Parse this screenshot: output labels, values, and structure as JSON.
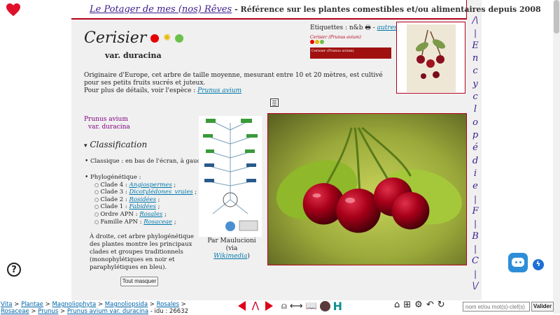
{
  "header": {
    "brand": "Le Potager de mes (nos) Rêves",
    "tagline": "- Référence sur les plantes comestibles et/ou alimentaires depuis 2008"
  },
  "plant": {
    "name": "Cerisier",
    "variety": "var. duracina",
    "description": "Originaire d'Europe, cet arbre de taille moyenne, mesurant entre 10 et 20 mètres, est cultivé pour ses petits fruits sucrés et juteux.",
    "details_prefix": "Pour plus de détails, voir l'espèce :",
    "details_link": "Prunus avium"
  },
  "labels": {
    "title": "Etiquettes : n&b",
    "others_link": "autres ex.",
    "mini_caption": "Cerisier (Prunus avium)",
    "mini_bar": "Cerisier (Prunus avium)"
  },
  "species": {
    "genus": "Prunus avium",
    "variety": "var. duracina"
  },
  "classification": {
    "heading": "Classification",
    "classic": "Classique : en bas de l'écran, à gauche.",
    "phylo_title": "Phylogénétique :",
    "items": [
      {
        "prefix": "Clade 4 : ",
        "link": "Angiospermes",
        "suffix": " ;"
      },
      {
        "prefix": "Clade 3 : ",
        "link": "Dicotylédones_vraies",
        "suffix": " ;"
      },
      {
        "prefix": "Clade 2 : ",
        "link": "Rosidées",
        "suffix": " ;"
      },
      {
        "prefix": "Clade 1 : ",
        "link": "Fabidées",
        "suffix": " ;"
      },
      {
        "prefix": "Ordre APN : ",
        "link": "Rosales",
        "suffix": " ;"
      },
      {
        "prefix": "Famille APN : ",
        "link": "Rosaceae",
        "suffix": " ;"
      }
    ],
    "note": "À droite, cet arbre phylogénétique des plantes montre les principaux clades et groupes traditionnels (monophylétiques en noir et paraphylétiques en bleu).",
    "credit_prefix": "Par Maulucioni",
    "credit_via": "(via ",
    "credit_link": "Wikimedia",
    "credit_close": ")"
  },
  "buttons": {
    "hide_all": "Tout masquer",
    "validate": "Valider"
  },
  "vertical_nav": [
    "/\\",
    "|",
    "E",
    "n",
    "c",
    "y",
    "c",
    "l",
    "o",
    "p",
    "é",
    "d",
    "i",
    "e",
    "|",
    "F",
    "|",
    "B",
    "|",
    "C",
    "|",
    "\\/"
  ],
  "breadcrumb": {
    "line1": [
      "Vita",
      "Plantae",
      "Magnoliophyta",
      "Magnoliopsida",
      "Rosales"
    ],
    "line2": [
      "Rosaceae",
      "Prunus",
      "Prunus avium var. duracina"
    ],
    "idu": "- idu : 26632"
  },
  "search": {
    "placeholder": "nom et/ou mot(s)-clef(s)"
  },
  "colors": {
    "accent_red": "#b3001b",
    "nav_purple": "#3a1a8c",
    "link_blue": "#0077aa"
  }
}
